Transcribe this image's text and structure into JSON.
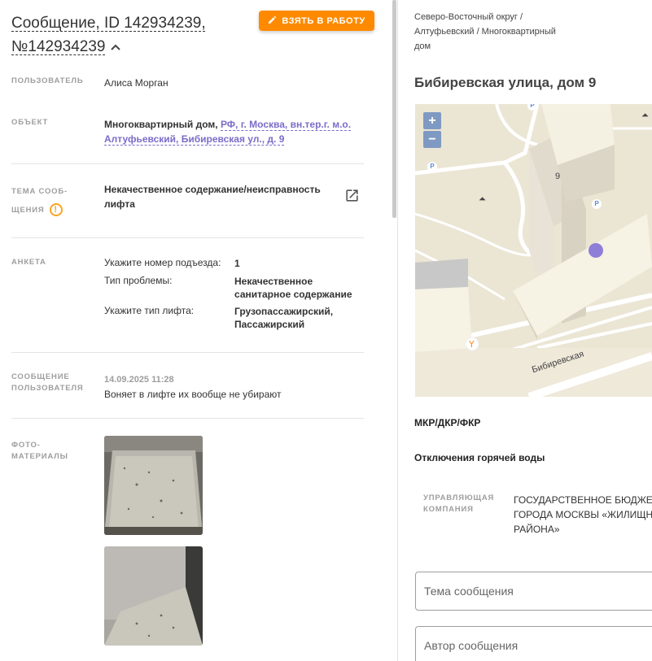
{
  "header": {
    "title_line1": "Сообщение, ID 142934239,",
    "title_line2": "№142934239",
    "take_button": "ВЗЯТЬ В РАБОТУ"
  },
  "fields": {
    "user_label": "ПОЛЬЗОВАТЕЛЬ",
    "user_value": "Алиса Морган",
    "object_label": "ОБЪЕКТ",
    "object_type": "Многоквартирный дом,",
    "object_link_1": "РФ, г. Москва, вн.тер.г. м.о.",
    "object_link_2": "Алтуфьевский, Бибиревская ул., д. 9",
    "topic_label_1": "ТЕМА СООБ-",
    "topic_label_2": "ЩЕНИЯ",
    "topic_value_1": "Некачественное содержание/неисправность",
    "topic_value_2": "лифта",
    "anketa_label": "АНКЕТА",
    "anketa": [
      {
        "q": "Укажите номер подъезда:",
        "a": "1"
      },
      {
        "q": "Тип проблемы:",
        "a": "Некачественное санитарное содержание"
      },
      {
        "q": "Укажите тип лифта:",
        "a": "Грузопассажирский, Пассажирский"
      }
    ],
    "message_label_1": "СООБЩЕНИЕ",
    "message_label_2": "ПОЛЬЗОВАТЕЛЯ",
    "message_date": "14.09.2025 11:28",
    "message_text": "Воняет в лифте их вообще не убирают",
    "photos_label_1": "ФОТО-",
    "photos_label_2": "МАТЕРИАЛЫ"
  },
  "right": {
    "crumb_1": "Северо-Восточный округ /",
    "crumb_2": "Алтуфьевский / Многоквартирный",
    "crumb_3": "дом",
    "address": "Бибиревская улица, дом 9",
    "map": {
      "zoom_in": "+",
      "zoom_out": "−",
      "building_number": "9",
      "street_label": "Бибиревская",
      "parking": "P"
    },
    "section_1": "МКР/ДКР/ФКР",
    "section_2": "Отключения горячей воды",
    "uk_label_1": "УПРАВЛЯЮЩАЯ",
    "uk_label_2": "КОМПАНИЯ",
    "uk_value_1": "ГОСУДАРСТВЕННОЕ БЮДЖЕТ",
    "uk_value_2": "ГОРОДА МОСКВЫ «ЖИЛИЩН",
    "uk_value_3": "РАЙОНА»",
    "field_topic_placeholder": "Тема сообщения",
    "field_author_placeholder": "Автор сообщения"
  },
  "colors": {
    "accent_orange": "#ff8a00",
    "link_purple": "#7b6cc9",
    "warn_orange": "#f5a623"
  }
}
